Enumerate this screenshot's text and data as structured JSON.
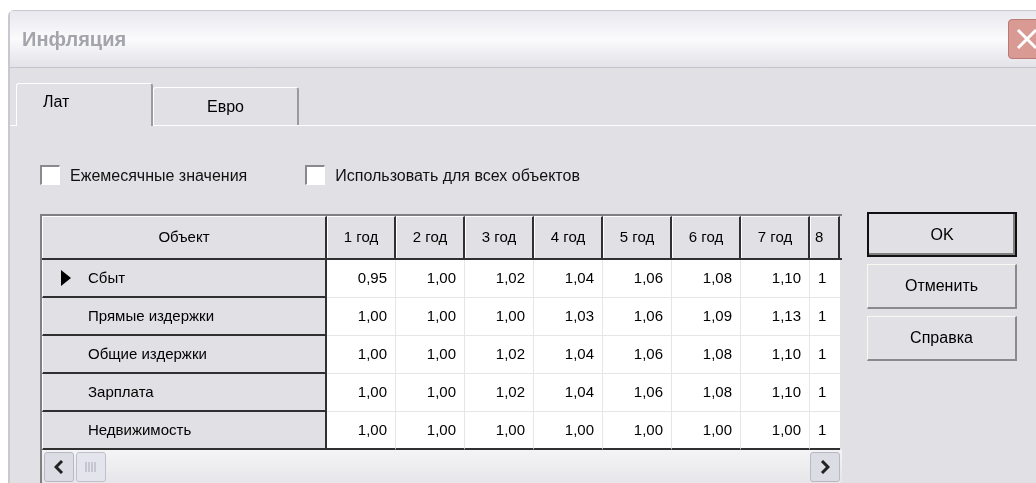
{
  "window": {
    "title": "Инфляция"
  },
  "tabs": [
    {
      "label": "Лат",
      "selected": true
    },
    {
      "label": "Евро",
      "selected": false
    }
  ],
  "options": [
    {
      "label": "Ежемесячные значения",
      "checked": false
    },
    {
      "label": "Использовать для всех объектов",
      "checked": false
    }
  ],
  "table": {
    "columns": [
      "Объект",
      "1 год",
      "2 год",
      "3 год",
      "4 год",
      "5 год",
      "6 год",
      "7 год",
      "8"
    ],
    "rows": [
      {
        "selected": true,
        "cells": [
          "Сбыт",
          "0,95",
          "1,00",
          "1,02",
          "1,04",
          "1,06",
          "1,08",
          "1,10",
          "1"
        ]
      },
      {
        "selected": false,
        "cells": [
          "Прямые издержки",
          "1,00",
          "1,00",
          "1,00",
          "1,03",
          "1,06",
          "1,09",
          "1,13",
          "1"
        ]
      },
      {
        "selected": false,
        "cells": [
          "Общие издержки",
          "1,00",
          "1,00",
          "1,02",
          "1,04",
          "1,06",
          "1,08",
          "1,10",
          "1"
        ]
      },
      {
        "selected": false,
        "cells": [
          "Зарплата",
          "1,00",
          "1,00",
          "1,02",
          "1,04",
          "1,06",
          "1,08",
          "1,10",
          "1"
        ]
      },
      {
        "selected": false,
        "cells": [
          "Недвижимость",
          "1,00",
          "1,00",
          "1,00",
          "1,00",
          "1,00",
          "1,00",
          "1,00",
          "1"
        ]
      }
    ]
  },
  "buttons": [
    {
      "label": "OK",
      "default": true
    },
    {
      "label": "Отменить",
      "default": false
    },
    {
      "label": "Справка",
      "default": false
    }
  ]
}
